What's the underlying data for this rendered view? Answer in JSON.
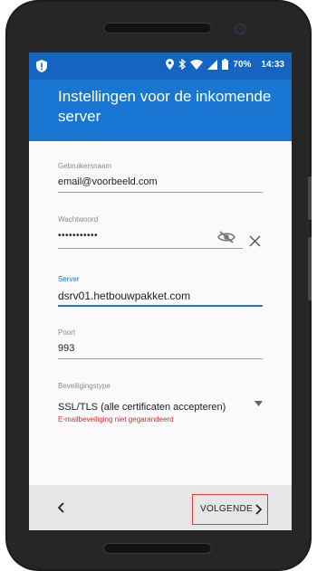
{
  "statusbar": {
    "battery": "70%",
    "time": "14:33",
    "icons": [
      "shield-alert-icon",
      "location-icon",
      "bluetooth-icon",
      "wifi-icon",
      "signal-icon",
      "battery-icon"
    ]
  },
  "header": {
    "title": "Instellingen voor de inkomende server"
  },
  "fields": {
    "username": {
      "label": "Gebruikersnaam",
      "value": "email@voorbeeld.com"
    },
    "password": {
      "label": "Wachtwoord",
      "value": "•••••••••••"
    },
    "server": {
      "label": "Server",
      "value": "dsrv01.hetbouwpakket.com"
    },
    "port": {
      "label": "Poort",
      "value": "993"
    },
    "security": {
      "label": "Beveiligingstype",
      "value": "SSL/TLS (alle certificaten accepteren)",
      "warning": "E-mailbeveiliging niet gegarandeerd"
    }
  },
  "bottombar": {
    "next_label": "VOLGENDE"
  },
  "colors": {
    "primary": "#1976d2",
    "statusbar": "#1565c0",
    "error": "#d32f2f",
    "highlight": "#e53935"
  }
}
